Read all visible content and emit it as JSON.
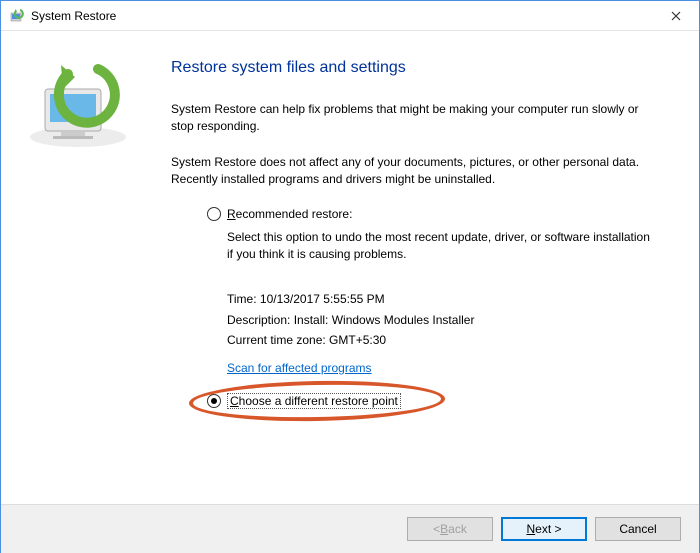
{
  "window": {
    "title": "System Restore"
  },
  "content": {
    "heading": "Restore system files and settings",
    "para1": "System Restore can help fix problems that might be making your computer run slowly or stop responding.",
    "para2": "System Restore does not affect any of your documents, pictures, or other personal data. Recently installed programs and drivers might be uninstalled.",
    "radio_recommended_prefix": "R",
    "radio_recommended_rest": "ecommended restore:",
    "recommended_desc": "Select this option to undo the most recent update, driver, or software installation if you think it is causing problems.",
    "time_label": "Time: ",
    "time_value": "10/13/2017 5:55:55 PM",
    "desc_label": "Description: ",
    "desc_value": "Install: Windows Modules Installer",
    "tz_label": "Current time zone: ",
    "tz_value": "GMT+5:30",
    "scan_link": "Scan for affected programs",
    "radio_choose_prefix": "C",
    "radio_choose_rest": "hoose a different restore point"
  },
  "footer": {
    "back_prefix": "< ",
    "back_ul": "B",
    "back_rest": "ack",
    "next_ul": "N",
    "next_rest": "ext >",
    "cancel": "Cancel"
  }
}
